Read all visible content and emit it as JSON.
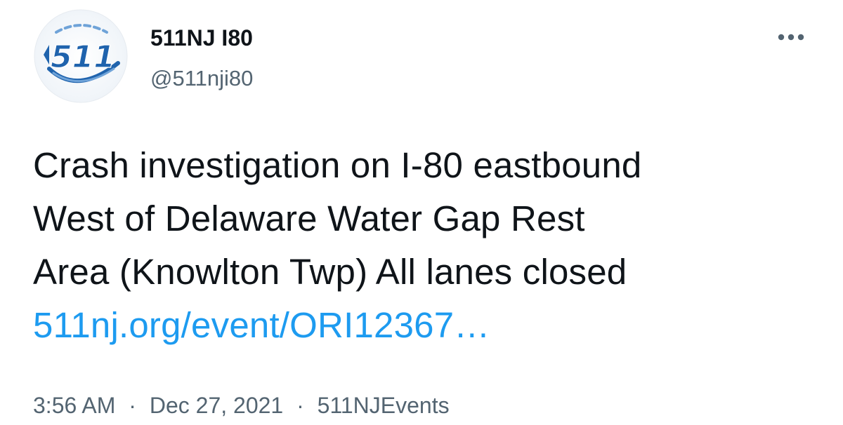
{
  "author": {
    "display_name": "511NJ I80",
    "handle": "@511nji80",
    "avatar_icon": "511-logo-icon",
    "avatar_text": "511"
  },
  "more_icon": "more-horizontal-icon",
  "tweet": {
    "lines": [
      "Crash investigation on I-80 eastbound",
      "West of Delaware Water Gap Rest",
      "Area (Knowlton Twp) All lanes closed"
    ],
    "link_text": "511nj.org/event/ORI12367…"
  },
  "meta": {
    "time": "3:56 AM",
    "separator": "·",
    "date": "Dec 27, 2021",
    "source": "511NJEvents"
  },
  "colors": {
    "text": "#0f1419",
    "secondary": "#536471",
    "link": "#1d9bf0",
    "logo_blue": "#1f63ad",
    "logo_blue_light": "#6fa3d8"
  }
}
